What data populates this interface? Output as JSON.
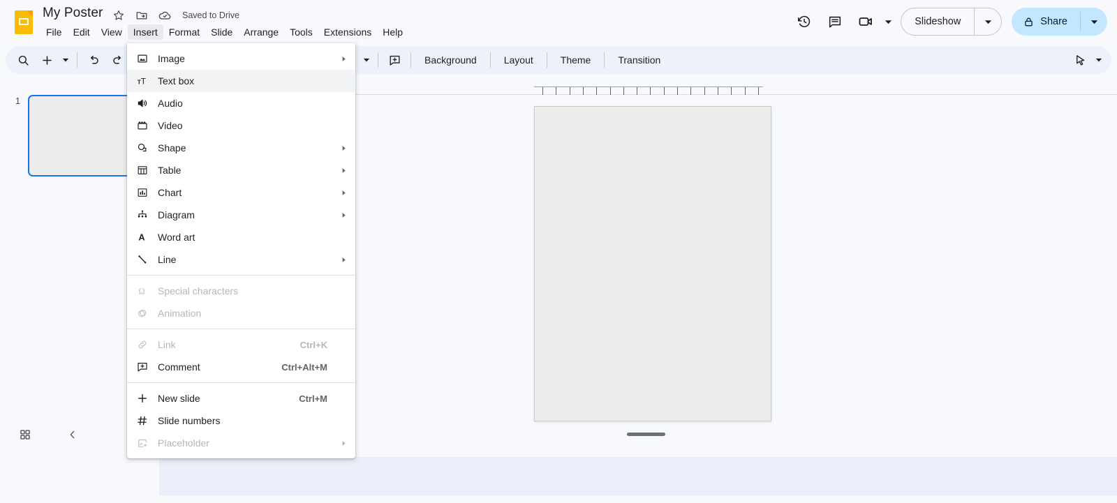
{
  "app": {
    "name": "Google Slides",
    "logo_icon": "slides-logo-icon"
  },
  "header": {
    "doc_title": "My Poster",
    "star_icon": "star-icon",
    "move_folder_icon": "move-to-folder-icon",
    "cloud_icon": "cloud-saved-icon",
    "save_status": "Saved to Drive",
    "menus": [
      {
        "label": "File",
        "active": false
      },
      {
        "label": "Edit",
        "active": false
      },
      {
        "label": "View",
        "active": false
      },
      {
        "label": "Insert",
        "active": true
      },
      {
        "label": "Format",
        "active": false
      },
      {
        "label": "Slide",
        "active": false
      },
      {
        "label": "Arrange",
        "active": false
      },
      {
        "label": "Tools",
        "active": false
      },
      {
        "label": "Extensions",
        "active": false
      },
      {
        "label": "Help",
        "active": false
      }
    ],
    "actions": {
      "version_history_icon": "version-history-icon",
      "comments_icon": "comment-history-icon",
      "meet_icon": "video-camera-icon",
      "meet_caret_icon": "chevron-down-icon",
      "slideshow_label": "Slideshow",
      "slideshow_caret_icon": "chevron-down-icon",
      "share_label": "Share",
      "share_lock_icon": "lock-icon",
      "share_caret_icon": "chevron-down-icon"
    }
  },
  "toolbar": {
    "search_icon": "search-icon",
    "plus_icon": "new-slide-plus-icon",
    "plus_caret_icon": "chevron-down-icon",
    "undo_icon": "undo-icon",
    "redo_icon": "redo-icon",
    "line_icon": "line-icon",
    "line_caret_icon": "chevron-down-icon",
    "comment_icon": "add-comment-icon",
    "background_label": "Background",
    "layout_label": "Layout",
    "theme_label": "Theme",
    "transition_label": "Transition",
    "cursor_icon": "select-cursor-icon",
    "cursor_caret_icon": "chevron-down-icon"
  },
  "filmstrip": {
    "slides": [
      {
        "number": "1",
        "selected": true
      }
    ],
    "grid_view_icon": "grid-view-icon",
    "collapse_icon": "chevron-left-icon"
  },
  "insert_menu": {
    "groups": [
      {
        "items": [
          {
            "label": "Image",
            "icon": "image-icon",
            "shortcut": "",
            "submenu": true,
            "disabled": false,
            "highlighted": false
          },
          {
            "label": "Text box",
            "icon": "text-box-icon",
            "shortcut": "",
            "submenu": false,
            "disabled": false,
            "highlighted": true
          },
          {
            "label": "Audio",
            "icon": "audio-icon",
            "shortcut": "",
            "submenu": false,
            "disabled": false,
            "highlighted": false
          },
          {
            "label": "Video",
            "icon": "video-icon",
            "shortcut": "",
            "submenu": false,
            "disabled": false,
            "highlighted": false
          },
          {
            "label": "Shape",
            "icon": "shape-icon",
            "shortcut": "",
            "submenu": true,
            "disabled": false,
            "highlighted": false
          },
          {
            "label": "Table",
            "icon": "table-icon",
            "shortcut": "",
            "submenu": true,
            "disabled": false,
            "highlighted": false
          },
          {
            "label": "Chart",
            "icon": "chart-icon",
            "shortcut": "",
            "submenu": true,
            "disabled": false,
            "highlighted": false
          },
          {
            "label": "Diagram",
            "icon": "diagram-icon",
            "shortcut": "",
            "submenu": true,
            "disabled": false,
            "highlighted": false
          },
          {
            "label": "Word art",
            "icon": "word-art-icon",
            "shortcut": "",
            "submenu": false,
            "disabled": false,
            "highlighted": false
          },
          {
            "label": "Line",
            "icon": "line-icon",
            "shortcut": "",
            "submenu": true,
            "disabled": false,
            "highlighted": false
          }
        ]
      },
      {
        "items": [
          {
            "label": "Special characters",
            "icon": "omega-icon",
            "shortcut": "",
            "submenu": false,
            "disabled": true,
            "highlighted": false
          },
          {
            "label": "Animation",
            "icon": "animation-icon",
            "shortcut": "",
            "submenu": false,
            "disabled": true,
            "highlighted": false
          }
        ]
      },
      {
        "items": [
          {
            "label": "Link",
            "icon": "link-icon",
            "shortcut": "Ctrl+K",
            "submenu": false,
            "disabled": true,
            "highlighted": false
          },
          {
            "label": "Comment",
            "icon": "add-comment-icon",
            "shortcut": "Ctrl+Alt+M",
            "submenu": false,
            "disabled": false,
            "highlighted": false
          }
        ]
      },
      {
        "items": [
          {
            "label": "New slide",
            "icon": "plus-icon",
            "shortcut": "Ctrl+M",
            "submenu": false,
            "disabled": false,
            "highlighted": false
          },
          {
            "label": "Slide numbers",
            "icon": "hash-icon",
            "shortcut": "",
            "submenu": false,
            "disabled": false,
            "highlighted": false
          },
          {
            "label": "Placeholder",
            "icon": "placeholder-icon",
            "shortcut": "",
            "submenu": true,
            "disabled": true,
            "highlighted": false
          }
        ]
      }
    ]
  },
  "canvas": {
    "ruler_tick_count": 17,
    "slide_background": "#ededeb"
  },
  "colors": {
    "accent_blue": "#1a73e8",
    "share_bg": "#c2e7ff",
    "toolbar_bg": "#edf1fa",
    "page_bg": "#f8f9fd",
    "notes_bg": "#eaeffa",
    "logo_yellow": "#fbbc04"
  }
}
